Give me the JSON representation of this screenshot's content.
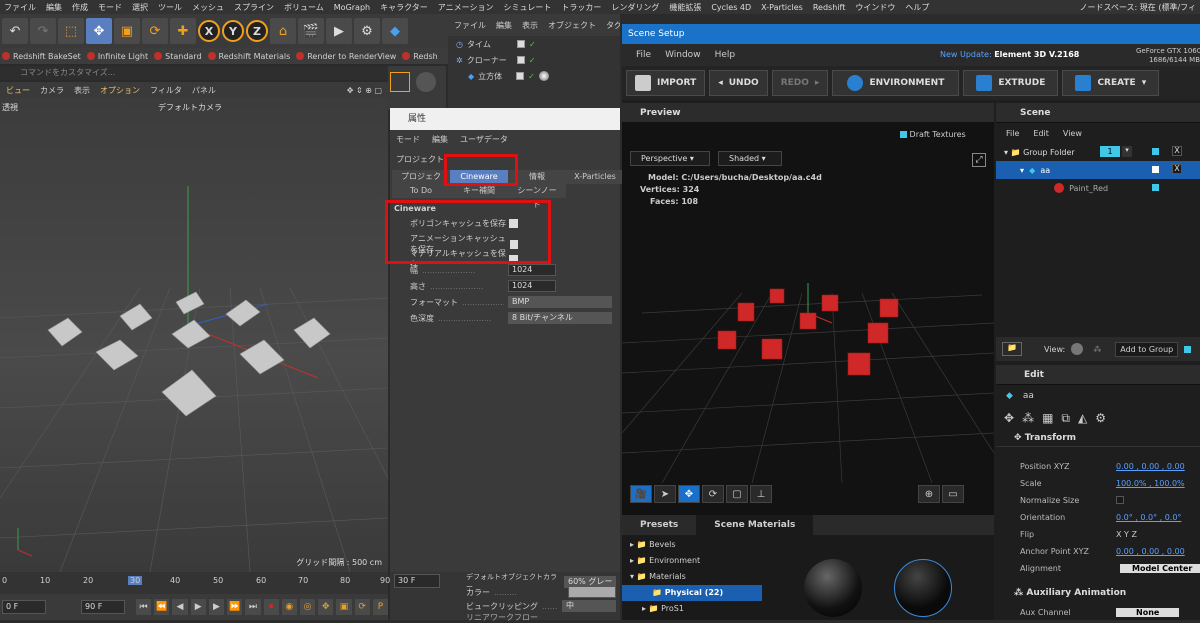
{
  "menubar": {
    "items": [
      "ファイル",
      "編集",
      "作成",
      "モード",
      "選択",
      "ツール",
      "メッシュ",
      "スプライン",
      "ボリューム",
      "MoGraph",
      "キャラクター",
      "アニメーション",
      "シミュレート",
      "トラッカー",
      "レンダリング",
      "機能拡張",
      "Cycles 4D",
      "X-Particles",
      "Redshift",
      "ウインドウ",
      "ヘルプ"
    ],
    "workspace": "ノードスペース: 現在 (標準/フィ"
  },
  "toolbar": {
    "axis_x": "X",
    "axis_y": "Y",
    "axis_z": "Z"
  },
  "plugbar": {
    "items": [
      "Redshift BakeSet",
      "Infinite Light",
      "Standard",
      "Redshift Materials",
      "Render to RenderView",
      "Redsh"
    ]
  },
  "command_placeholder": "コマンドをカスタマイズ...",
  "viewport": {
    "menu": [
      "ビュー",
      "カメラ",
      "表示",
      "オプション",
      "フィルタ",
      "パネル"
    ],
    "view_name": "透視",
    "camera": "デフォルトカメラ",
    "grid_spacing": "グリッド間隔 : 500 cm"
  },
  "timeline": {
    "ticks": [
      "0",
      "10",
      "20",
      "30",
      "40",
      "50",
      "60",
      "70",
      "80",
      "90"
    ],
    "current_frame": "0 F",
    "end_frame": "90 F",
    "start_field": "0 F",
    "end_field": "90 F"
  },
  "objects": {
    "menu": [
      "ファイル",
      "編集",
      "表示",
      "オブジェクト",
      "タグ"
    ],
    "rows": [
      "タイム",
      "クローナー",
      "立方体"
    ]
  },
  "attributes": {
    "title": "属性",
    "menu": [
      "モード",
      "編集",
      "ユーザデータ"
    ],
    "project_label": "プロジェクト",
    "tabs_row1": [
      "プロジェクト設定",
      "Cineware",
      "情報",
      "X-Particles"
    ],
    "tabs_row2": [
      "To Do",
      "キー補間",
      "シーンノード"
    ],
    "section": "Cineware",
    "checks": [
      {
        "label": "ポリゴンキャッシュを保存",
        "checked": true
      },
      {
        "label": "アニメーションキャッシュを保存",
        "checked": true
      },
      {
        "label": "マテリアルキャッシュを保存",
        "checked": true
      }
    ],
    "props": [
      {
        "label": "幅",
        "value": "1024"
      },
      {
        "label": "高さ",
        "value": "1024"
      },
      {
        "label": "フォーマット",
        "value": "BMP"
      },
      {
        "label": "色深度",
        "value": "8 Bit/チャンネル"
      }
    ],
    "bottom": [
      {
        "label": "デフォルトオブジェクトカラー",
        "value": "60% グレー"
      },
      {
        "label": "カラー",
        "value": ""
      },
      {
        "label": "ビュークリッピング",
        "value": "中"
      },
      {
        "label": "リニアワークフロー",
        "value": ""
      }
    ],
    "frame_field": "30 F"
  },
  "element": {
    "window_title": "Scene Setup",
    "menu": [
      "File",
      "Window",
      "Help"
    ],
    "update_label": "New Update:",
    "update_version": "Element 3D V.2168",
    "gpu_name": "GeForce GTX 1060 6GB",
    "gpu_mem": "1686/6144 MB",
    "buttons": [
      "IMPORT",
      "UNDO",
      "REDO",
      "ENVIRONMENT",
      "EXTRUDE",
      "CREATE"
    ],
    "preview": {
      "header": "Preview",
      "draft_textures": "Draft Textures",
      "view_mode": "Perspective",
      "shade_mode": "Shaded",
      "model_label": "Model:",
      "model_path": "C:/Users/bucha/Desktop/aa.c4d",
      "vertices_label": "Vertices:",
      "vertices": "324",
      "faces_label": "Faces:",
      "faces": "108"
    },
    "presets": {
      "tabs": [
        "Presets",
        "Scene Materials"
      ],
      "tree": [
        "Bevels",
        "Environment",
        "Materials",
        "Physical (22)",
        "ProS1"
      ]
    },
    "scene": {
      "header": "Scene",
      "menu": [
        "File",
        "Edit",
        "View"
      ],
      "group": "Group Folder",
      "group_num": "1",
      "object": "aa",
      "material": "Paint_Red",
      "view_label": "View:",
      "add_to_group": "Add to Group"
    },
    "edit": {
      "header": "Edit",
      "object": "aa",
      "transform": "Transform",
      "rows": [
        {
          "label": "Position XYZ",
          "value": "0.00 , 0.00 , 0.00"
        },
        {
          "label": "Scale",
          "value": "100.0% , 100.0%"
        },
        {
          "label": "Normalize Size",
          "value": ""
        },
        {
          "label": "Orientation",
          "value": "0.0° , 0.0° , 0.0°"
        },
        {
          "label": "Flip",
          "value": "X   Y   Z"
        },
        {
          "label": "Anchor Point XYZ",
          "value": "0.00 , 0.00 , 0.00"
        },
        {
          "label": "Alignment",
          "value": "Model Center"
        }
      ],
      "aux": "Auxiliary Animation",
      "aux_channel": "Aux Channel",
      "aux_value": "None"
    }
  }
}
